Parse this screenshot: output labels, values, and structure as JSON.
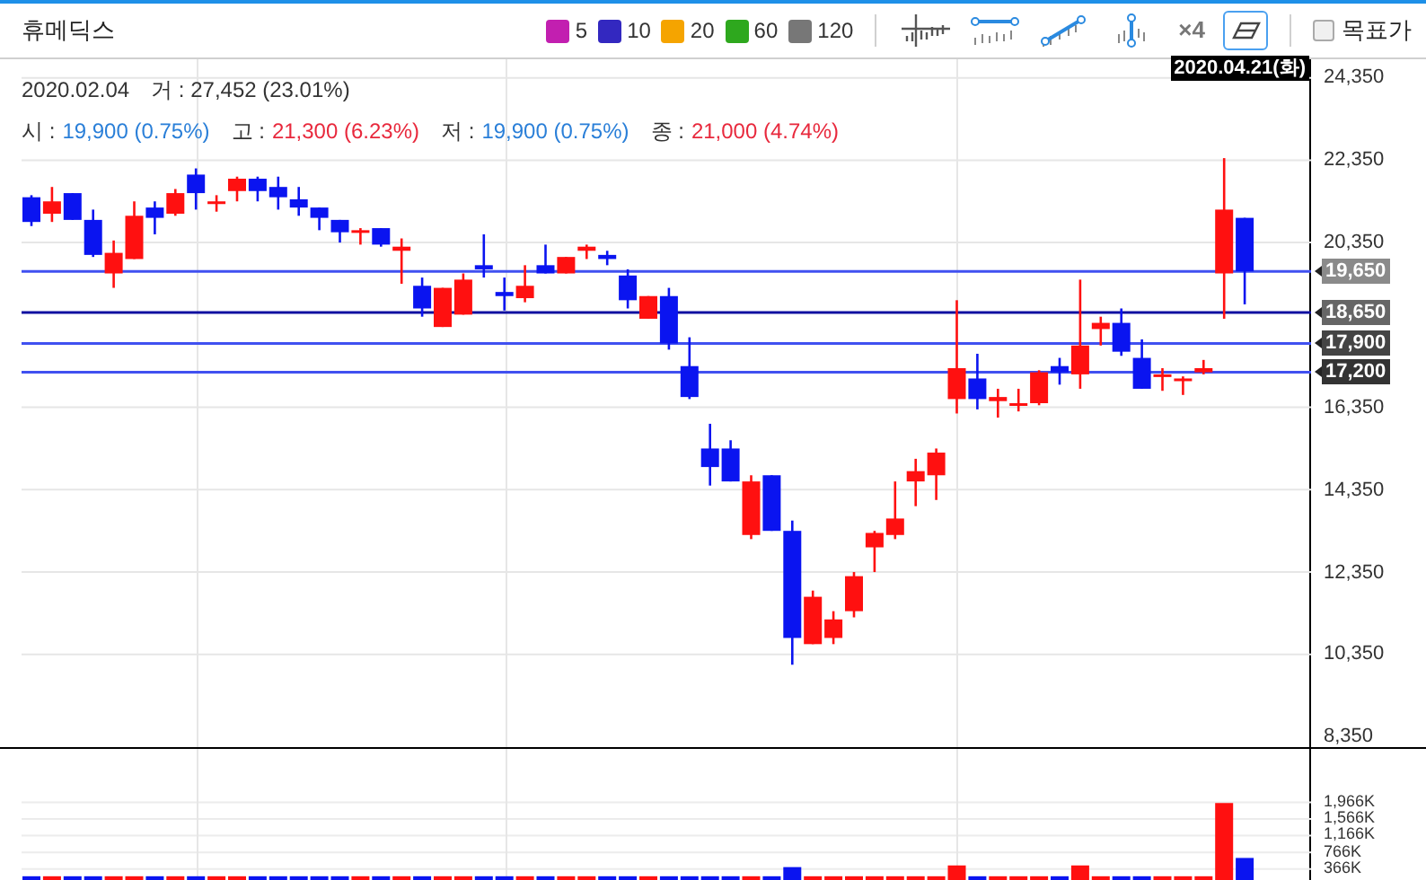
{
  "header": {
    "title": "휴메딕스",
    "legend": [
      {
        "label": "5",
        "color": "#c21fb0"
      },
      {
        "label": "10",
        "color": "#3328c0"
      },
      {
        "label": "20",
        "color": "#f5a400"
      },
      {
        "label": "60",
        "color": "#2ea81e"
      },
      {
        "label": "120",
        "color": "#777777"
      }
    ],
    "tools": [
      {
        "kind": "crosshair",
        "selected": false
      },
      {
        "kind": "hline",
        "selected": false
      },
      {
        "kind": "trend",
        "selected": false
      },
      {
        "kind": "vline",
        "selected": false
      },
      {
        "kind": "zoom",
        "label": "×4",
        "selected": false
      },
      {
        "kind": "eraser",
        "selected": true
      }
    ],
    "target_price": {
      "label": "목표가",
      "checked": false
    }
  },
  "info": {
    "date": "2020.02.04",
    "volume": {
      "label": "거",
      "separator": ":",
      "value": "27,452 (23.01%)"
    },
    "prices": [
      {
        "label": "시",
        "separator": ":",
        "value": "19,900 (0.75%)",
        "color": "#2a7fd8"
      },
      {
        "label": "고",
        "separator": ":",
        "value": "21,300 (6.23%)",
        "color": "#e8283c"
      },
      {
        "label": "저",
        "separator": ":",
        "value": "19,900 (0.75%)",
        "color": "#2a7fd8"
      },
      {
        "label": "종",
        "separator": ":",
        "value": "21,000 (4.74%)",
        "color": "#e8283c"
      }
    ]
  },
  "crosshair_label": "2020.04.21(화)",
  "price_chart": {
    "chart_data": {
      "type": "candlestick",
      "grid": true,
      "ylim": [
        8100,
        24800
      ],
      "ohlc": [
        [
          21450,
          21500,
          20750,
          20850
        ],
        [
          21050,
          21700,
          20850,
          21350
        ],
        [
          21550,
          21550,
          20900,
          20900
        ],
        [
          20900,
          21150,
          20000,
          20050
        ],
        [
          19600,
          20400,
          19250,
          20100
        ],
        [
          19950,
          21350,
          19950,
          21000
        ],
        [
          21200,
          21350,
          20550,
          20950
        ],
        [
          21050,
          21650,
          21000,
          21550
        ],
        [
          22000,
          22150,
          21150,
          21550
        ],
        [
          21300,
          21500,
          21100,
          21350
        ],
        [
          21600,
          21950,
          21350,
          21900
        ],
        [
          21900,
          21950,
          21350,
          21600
        ],
        [
          21700,
          21950,
          21150,
          21450
        ],
        [
          21400,
          21700,
          21000,
          21200
        ],
        [
          21200,
          21200,
          20650,
          20950
        ],
        [
          20900,
          20900,
          20350,
          20600
        ],
        [
          20600,
          20700,
          20300,
          20650
        ],
        [
          20700,
          20700,
          20250,
          20300
        ],
        [
          20150,
          20450,
          19350,
          20250
        ],
        [
          19300,
          19500,
          18550,
          18750
        ],
        [
          18300,
          19250,
          18300,
          19250
        ],
        [
          18600,
          19600,
          18600,
          19450
        ],
        [
          19800,
          20550,
          19500,
          19700
        ],
        [
          19150,
          19500,
          18700,
          19050
        ],
        [
          19000,
          19800,
          18900,
          19300
        ],
        [
          19800,
          20300,
          19600,
          19600
        ],
        [
          19600,
          20000,
          19600,
          20000
        ],
        [
          20150,
          20300,
          19950,
          20250
        ],
        [
          20050,
          20150,
          19800,
          19950
        ],
        [
          19550,
          19700,
          18750,
          18950
        ],
        [
          18500,
          19050,
          18500,
          19050
        ],
        [
          19050,
          19250,
          17750,
          17900
        ],
        [
          17350,
          18050,
          16550,
          16600
        ],
        [
          15350,
          15950,
          14450,
          14900
        ],
        [
          15350,
          15550,
          14550,
          14550
        ],
        [
          13250,
          14700,
          13150,
          14550
        ],
        [
          14700,
          14700,
          13350,
          13350
        ],
        [
          13350,
          13600,
          10100,
          10750
        ],
        [
          10600,
          11900,
          10600,
          11750
        ],
        [
          10750,
          11400,
          10600,
          11200
        ],
        [
          11400,
          12350,
          11250,
          12250
        ],
        [
          12950,
          13350,
          12350,
          13300
        ],
        [
          13250,
          14550,
          13150,
          13650
        ],
        [
          14550,
          15100,
          13950,
          14800
        ],
        [
          14700,
          15350,
          14100,
          15250
        ],
        [
          16550,
          18950,
          16200,
          17300
        ],
        [
          17050,
          17650,
          16300,
          16550
        ],
        [
          16500,
          16800,
          16100,
          16600
        ],
        [
          16400,
          16800,
          16250,
          16450
        ],
        [
          16450,
          17250,
          16400,
          17200
        ],
        [
          17350,
          17550,
          16900,
          17200
        ],
        [
          17150,
          19450,
          16800,
          17850
        ],
        [
          18250,
          18550,
          17850,
          18400
        ],
        [
          18400,
          18750,
          17600,
          17700
        ],
        [
          17550,
          18000,
          16800,
          16800
        ],
        [
          17100,
          17300,
          16750,
          17150
        ],
        [
          17000,
          17100,
          16650,
          17050
        ],
        [
          17200,
          17500,
          17150,
          17300
        ],
        [
          19600,
          22400,
          18500,
          21150
        ],
        [
          20950,
          20950,
          18850,
          19650
        ]
      ],
      "yticks": [
        {
          "value": 24350,
          "label": "24,350"
        },
        {
          "value": 22350,
          "label": "22,350"
        },
        {
          "value": 20350,
          "label": "20,350"
        },
        {
          "value": 16350,
          "label": "16,350"
        },
        {
          "value": 14350,
          "label": "14,350"
        },
        {
          "value": 12350,
          "label": "12,350"
        },
        {
          "value": 10350,
          "label": "10,350"
        },
        {
          "value": 8350,
          "label": "8,350"
        }
      ],
      "ref_lines": [
        {
          "axis": "y",
          "value": 19650,
          "label": "19,650"
        },
        {
          "axis": "y",
          "value": 18650,
          "label": "18,650"
        },
        {
          "axis": "y",
          "value": 17900,
          "label": "17,900"
        },
        {
          "axis": "y",
          "value": 17200,
          "label": "17,200"
        }
      ]
    }
  },
  "volume_chart": {
    "chart_data": {
      "type": "bar",
      "grid": true,
      "ylim": [
        100,
        3250
      ],
      "values": [
        190,
        190,
        190,
        190,
        190,
        190,
        190,
        190,
        190,
        190,
        190,
        190,
        190,
        190,
        190,
        190,
        190,
        190,
        190,
        190,
        190,
        190,
        190,
        190,
        190,
        190,
        190,
        190,
        190,
        190,
        190,
        190,
        190,
        190,
        190,
        190,
        190,
        410,
        190,
        190,
        190,
        190,
        190,
        190,
        190,
        450,
        190,
        190,
        190,
        190,
        190,
        450,
        190,
        190,
        190,
        190,
        190,
        190,
        1950,
        630
      ],
      "yticks": [
        {
          "value": 1966,
          "label": "1,966K"
        },
        {
          "value": 1566,
          "label": "1,566K"
        },
        {
          "value": 1166,
          "label": "1,166K"
        },
        {
          "value": 766,
          "label": "766K"
        },
        {
          "value": 366,
          "label": "366K"
        }
      ]
    }
  }
}
